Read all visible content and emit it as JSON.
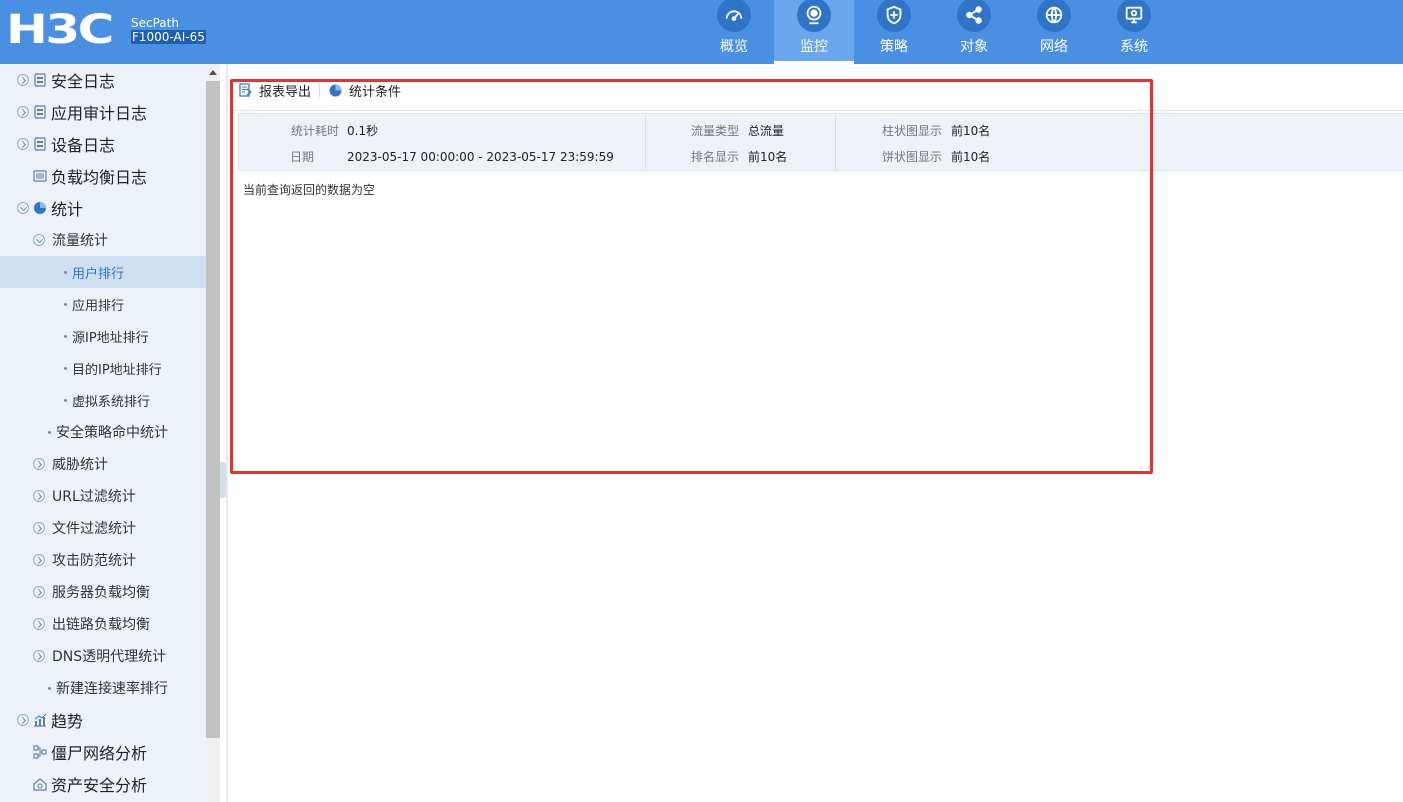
{
  "header": {
    "logo": "H3C",
    "product_line": "SecPath",
    "product_model": "F1000-AI-65",
    "nav": [
      {
        "label": "概览",
        "icon": "dashboard-icon"
      },
      {
        "label": "监控",
        "icon": "monitor-camera-icon"
      },
      {
        "label": "策略",
        "icon": "shield-plus-icon"
      },
      {
        "label": "对象",
        "icon": "share-nodes-icon"
      },
      {
        "label": "网络",
        "icon": "globe-icon"
      },
      {
        "label": "系统",
        "icon": "computer-gear-icon"
      }
    ],
    "active_nav": "监控"
  },
  "sidebar": {
    "items": [
      {
        "label": "安全日志"
      },
      {
        "label": "应用审计日志"
      },
      {
        "label": "设备日志"
      },
      {
        "label": "负载均衡日志"
      },
      {
        "label": "统计"
      },
      {
        "label": "流量统计"
      },
      {
        "label": "用户排行"
      },
      {
        "label": "应用排行"
      },
      {
        "label": "源IP地址排行"
      },
      {
        "label": "目的IP地址排行"
      },
      {
        "label": "虚拟系统排行"
      },
      {
        "label": "安全策略命中统计"
      },
      {
        "label": "威胁统计"
      },
      {
        "label": "URL过滤统计"
      },
      {
        "label": "文件过滤统计"
      },
      {
        "label": "攻击防范统计"
      },
      {
        "label": "服务器负载均衡"
      },
      {
        "label": "出链路负载均衡"
      },
      {
        "label": "DNS透明代理统计"
      },
      {
        "label": "新建连接速率排行"
      },
      {
        "label": "趋势"
      },
      {
        "label": "僵尸网络分析"
      },
      {
        "label": "资产安全分析"
      }
    ],
    "selected": "用户排行"
  },
  "toolbar": {
    "export_label": "报表导出",
    "conditions_label": "统计条件"
  },
  "stats": {
    "elapsed_label": "统计耗时",
    "elapsed_value": "0.1秒",
    "date_label": "日期",
    "date_value": "2023-05-17 00:00:00 - 2023-05-17 23:59:59",
    "traffic_type_label": "流量类型",
    "traffic_type_value": "总流量",
    "rank_label": "排名显示",
    "rank_value": "前10名",
    "bar_label": "柱状图显示",
    "bar_value": "前10名",
    "pie_label": "饼状图显示",
    "pie_value": "前10名"
  },
  "empty_message": "当前查询返回的数据为空",
  "colors": {
    "header_bg": "#4a90e2",
    "nav_active_bg": "#6aa6ec",
    "sidebar_bg": "#edf2f9",
    "sidebar_selected_bg": "#cfdff2",
    "highlight_border": "#e8302e"
  }
}
